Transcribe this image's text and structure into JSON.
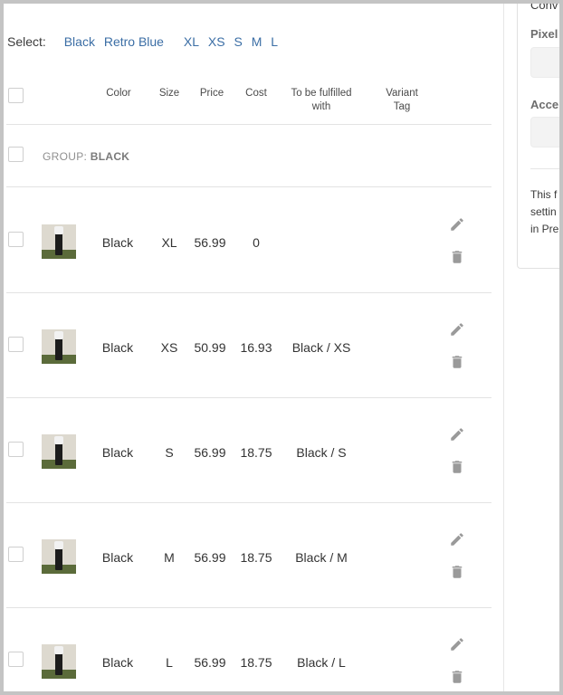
{
  "side": {
    "line1": "Conv",
    "pixel_label": "Pixel",
    "access_label": "Acce",
    "para": [
      "This f",
      "settin",
      "in Pre"
    ]
  },
  "select": {
    "label": "Select:",
    "colors": [
      "Black",
      "Retro Blue"
    ],
    "sizes": [
      "XL",
      "XS",
      "S",
      "M",
      "L"
    ]
  },
  "table": {
    "headers": {
      "color": "Color",
      "size": "Size",
      "price": "Price",
      "cost": "Cost",
      "fulfilled": "To be fulfilled with",
      "tag": "Variant Tag"
    },
    "group_prefix": "GROUP: ",
    "group_name": "BLACK",
    "rows": [
      {
        "color": "Black",
        "size": "XL",
        "price": "56.99",
        "cost": "0",
        "fulfilled": ""
      },
      {
        "color": "Black",
        "size": "XS",
        "price": "50.99",
        "cost": "16.93",
        "fulfilled": "Black / XS"
      },
      {
        "color": "Black",
        "size": "S",
        "price": "56.99",
        "cost": "18.75",
        "fulfilled": "Black / S"
      },
      {
        "color": "Black",
        "size": "M",
        "price": "56.99",
        "cost": "18.75",
        "fulfilled": "Black / M"
      },
      {
        "color": "Black",
        "size": "L",
        "price": "56.99",
        "cost": "18.75",
        "fulfilled": "Black / L"
      }
    ]
  },
  "icons": {
    "edit": "pencil-icon",
    "delete": "trash-icon"
  },
  "colors": {
    "link": "#3b6ea5",
    "icon": "#9a9a9a"
  }
}
